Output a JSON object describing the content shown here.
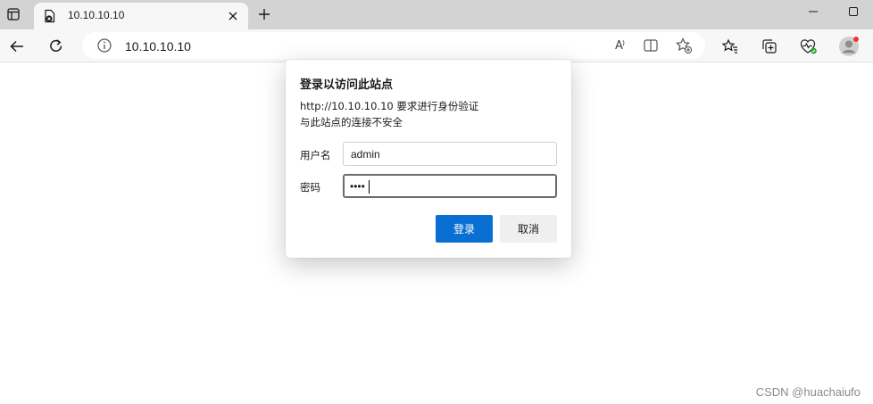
{
  "browser": {
    "tab": {
      "title": "10.10.10.10",
      "favicon_icon": "document-blocked-icon"
    },
    "address_bar": {
      "url": "10.10.10.10",
      "site_info_icon": "info-icon"
    },
    "toolbar_icons": [
      "back-arrow-icon",
      "refresh-icon",
      "read-aloud-icon",
      "split-screen-icon",
      "add-favorite-icon",
      "favorites-icon",
      "collections-icon",
      "browser-essentials-icon",
      "profile-avatar-icon"
    ],
    "read_aloud_label": "A⁾"
  },
  "auth_dialog": {
    "title": "登录以访问此站点",
    "message_line1": "http://10.10.10.10 要求进行身份验证",
    "message_line2": "与此站点的连接不安全",
    "username_label": "用户名",
    "username_value": "admin",
    "password_label": "密码",
    "password_masked": "••••",
    "sign_in_button": "登录",
    "cancel_button": "取消",
    "colors": {
      "primary": "#0a6fd3",
      "secondary": "#efefef"
    }
  },
  "watermark": "CSDN @huachaiufo"
}
